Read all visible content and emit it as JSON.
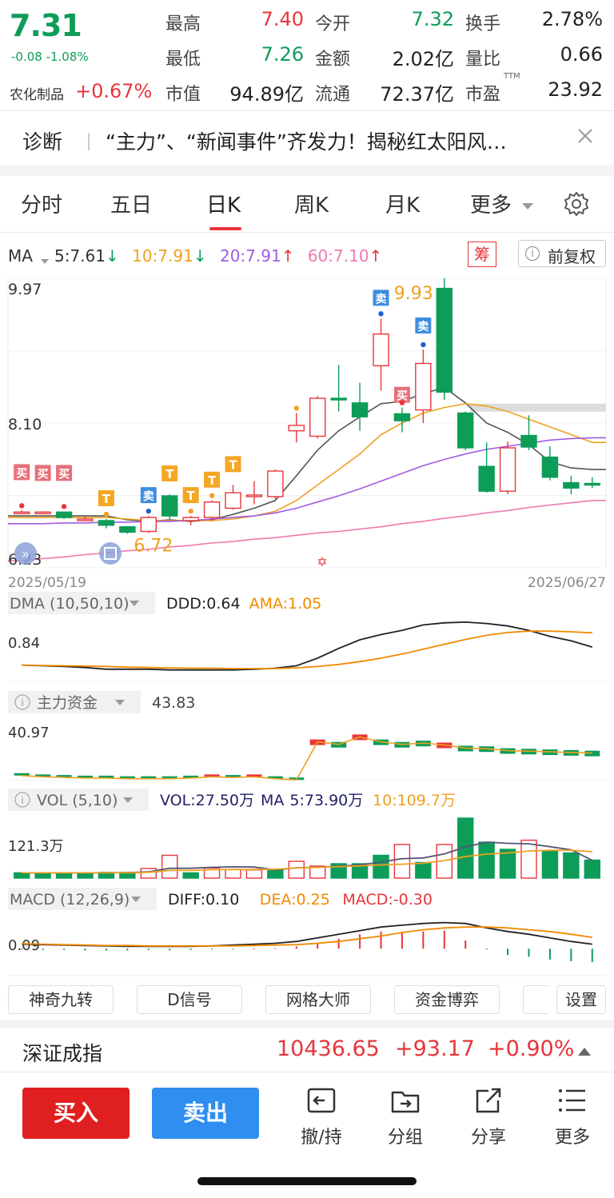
{
  "quote": {
    "price": "7.31",
    "change": "-0.08 -1.08%",
    "sector": "农化制品",
    "sector_change": "+0.67%",
    "fields": [
      {
        "label": "最高",
        "value": "7.40",
        "color": "#e8353b"
      },
      {
        "label": "今开",
        "value": "7.32",
        "color": "#0d9d58"
      },
      {
        "label": "换手",
        "value": "2.78%",
        "color": "#222222"
      },
      {
        "label": "最低",
        "value": "7.26",
        "color": "#0d9d58"
      },
      {
        "label": "金额",
        "value": "2.02亿",
        "color": "#222222"
      },
      {
        "label": "量比",
        "value": "0.66",
        "color": "#222222"
      },
      {
        "label": "市值",
        "value": "94.89亿",
        "color": "#222222"
      },
      {
        "label": "流通",
        "value": "72.37亿",
        "color": "#222222"
      },
      {
        "label": "市盈",
        "value": "23.92",
        "color": "#222222"
      }
    ],
    "pe_superscript": "TTM"
  },
  "news": {
    "label": "诊断",
    "headline": "“主力”、“新闻事件”齐发力！揭秘红太阳风…"
  },
  "tabs": [
    "分时",
    "五日",
    "日K",
    "周K",
    "月K",
    "更多"
  ],
  "active_tab": "日K",
  "ma_bar": {
    "label": "MA",
    "items": [
      {
        "text": "5:7.61",
        "arrow": "↓",
        "color": "#333333",
        "arrow_color": "#0d9d58"
      },
      {
        "text": "10:7.91",
        "arrow": "↓",
        "color": "#f0a020",
        "arrow_color": "#0d9d58"
      },
      {
        "text": "20:7.91",
        "arrow": "↑",
        "color": "#a05de0",
        "arrow_color": "#e8353b"
      },
      {
        "text": "60:7.10",
        "arrow": "↑",
        "color": "#f07ab0",
        "arrow_color": "#e8353b"
      }
    ],
    "chip_label": "筹",
    "adjust_label": "前复权"
  },
  "chart_data": [
    {
      "type": "candlestick",
      "title": "",
      "y_ticks": [
        "9.97",
        "8.10",
        "6.23"
      ],
      "ylim": [
        6.23,
        9.97
      ],
      "x_labels": [
        "2025/05/19",
        "2025/06/27"
      ],
      "annotations": [
        {
          "text": "9.93",
          "kind": "high"
        },
        {
          "text": "6.72",
          "kind": "low"
        }
      ],
      "signals": [
        "买",
        "买",
        "买",
        "T",
        "卖",
        "T",
        "T",
        "T",
        "T",
        "卖",
        "买",
        "卖"
      ],
      "candles": [
        {
          "o": 6.94,
          "c": 6.95,
          "h": 6.97,
          "l": 6.93
        },
        {
          "o": 6.94,
          "c": 6.95,
          "h": 6.96,
          "l": 6.92
        },
        {
          "o": 6.95,
          "c": 6.88,
          "h": 6.96,
          "l": 6.86
        },
        {
          "o": 6.86,
          "c": 6.86,
          "h": 6.89,
          "l": 6.84
        },
        {
          "o": 6.84,
          "c": 6.78,
          "h": 6.86,
          "l": 6.74
        },
        {
          "o": 6.76,
          "c": 6.69,
          "h": 6.77,
          "l": 6.67
        },
        {
          "o": 6.7,
          "c": 6.88,
          "h": 6.9,
          "l": 6.68
        },
        {
          "o": 7.16,
          "c": 6.9,
          "h": 7.18,
          "l": 6.86
        },
        {
          "o": 6.84,
          "c": 6.88,
          "h": 6.9,
          "l": 6.78
        },
        {
          "o": 6.88,
          "c": 7.08,
          "h": 7.1,
          "l": 6.84
        },
        {
          "o": 7.0,
          "c": 7.2,
          "h": 7.3,
          "l": 6.98
        },
        {
          "o": 7.15,
          "c": 7.17,
          "h": 7.35,
          "l": 7.05
        },
        {
          "o": 7.15,
          "c": 7.48,
          "h": 7.5,
          "l": 7.12
        },
        {
          "o": 8.0,
          "c": 8.07,
          "h": 8.23,
          "l": 7.85
        },
        {
          "o": 7.93,
          "c": 8.42,
          "h": 8.45,
          "l": 7.9
        },
        {
          "o": 8.42,
          "c": 8.4,
          "h": 8.85,
          "l": 8.25
        },
        {
          "o": 8.36,
          "c": 8.18,
          "h": 8.62,
          "l": 8.0
        },
        {
          "o": 8.84,
          "c": 9.25,
          "h": 9.45,
          "l": 8.52
        },
        {
          "o": 8.22,
          "c": 8.13,
          "h": 8.3,
          "l": 7.98
        },
        {
          "o": 8.27,
          "c": 8.87,
          "h": 9.05,
          "l": 8.1
        },
        {
          "o": 9.84,
          "c": 8.5,
          "h": 9.97,
          "l": 8.4
        },
        {
          "o": 8.23,
          "c": 7.78,
          "h": 8.25,
          "l": 7.75
        },
        {
          "o": 7.54,
          "c": 7.22,
          "h": 7.85,
          "l": 7.2
        },
        {
          "o": 7.22,
          "c": 7.78,
          "h": 7.86,
          "l": 7.18
        },
        {
          "o": 7.94,
          "c": 7.79,
          "h": 8.2,
          "l": 7.75
        },
        {
          "o": 7.66,
          "c": 7.4,
          "h": 7.8,
          "l": 7.36
        },
        {
          "o": 7.33,
          "c": 7.26,
          "h": 7.42,
          "l": 7.18
        },
        {
          "o": 7.32,
          "c": 7.31,
          "h": 7.4,
          "l": 7.26
        }
      ],
      "series": [
        {
          "name": "MA5",
          "color": "#555555",
          "values": [
            null,
            null,
            null,
            null,
            6.9,
            6.85,
            6.83,
            6.85,
            6.83,
            6.85,
            6.92,
            7.0,
            7.1,
            7.42,
            7.75,
            8.0,
            8.18,
            8.35,
            8.38,
            8.48,
            8.56,
            8.36,
            8.1,
            7.98,
            7.82,
            7.6,
            7.52,
            7.5
          ]
        },
        {
          "name": "MA10",
          "color": "#f0a020",
          "values": [
            null,
            null,
            null,
            null,
            6.88,
            6.86,
            6.84,
            6.84,
            6.84,
            6.84,
            6.86,
            6.9,
            6.96,
            7.1,
            7.3,
            7.5,
            7.7,
            7.95,
            8.1,
            8.23,
            8.3,
            8.35,
            8.32,
            8.25,
            8.15,
            8.05,
            7.95,
            7.85
          ]
        },
        {
          "name": "MA20",
          "color": "#a05de0",
          "values": [
            6.8,
            6.8,
            6.81,
            6.81,
            6.82,
            6.82,
            6.83,
            6.83,
            6.84,
            6.86,
            6.88,
            6.9,
            6.94,
            7.0,
            7.08,
            7.16,
            7.25,
            7.35,
            7.45,
            7.55,
            7.63,
            7.7,
            7.76,
            7.8,
            7.84,
            7.88,
            7.9,
            7.91
          ]
        },
        {
          "name": "MA60",
          "color": "#f07ab0",
          "values": [
            6.32,
            6.35,
            6.37,
            6.4,
            6.42,
            6.45,
            6.47,
            6.5,
            6.52,
            6.55,
            6.57,
            6.6,
            6.62,
            6.65,
            6.68,
            6.7,
            6.73,
            6.76,
            6.8,
            6.83,
            6.87,
            6.9,
            6.94,
            6.97,
            7.01,
            7.04,
            7.07,
            7.1
          ]
        }
      ]
    },
    {
      "type": "line",
      "title": "DMA (10,50,10)",
      "legend": [
        {
          "text": "DDD:0.64",
          "color": "#222222"
        },
        {
          "text": "AMA:1.05",
          "color": "#f08a00"
        }
      ],
      "y_ticks": [
        "0.84"
      ],
      "ylim": [
        -0.35,
        1.45
      ],
      "series": [
        {
          "name": "DDD",
          "color": "#222222",
          "values": [
            0.12,
            0.1,
            0.08,
            0.05,
            0.0,
            0.0,
            0.0,
            -0.02,
            -0.02,
            -0.02,
            -0.02,
            0.0,
            0.03,
            0.1,
            0.32,
            0.6,
            0.85,
            1.0,
            1.12,
            1.28,
            1.34,
            1.36,
            1.32,
            1.25,
            1.12,
            0.95,
            0.82,
            0.64
          ]
        },
        {
          "name": "AMA",
          "color": "#f08a00",
          "values": [
            0.12,
            0.11,
            0.1,
            0.09,
            0.08,
            0.06,
            0.05,
            0.04,
            0.03,
            0.03,
            0.02,
            0.02,
            0.02,
            0.04,
            0.08,
            0.14,
            0.22,
            0.32,
            0.44,
            0.58,
            0.72,
            0.86,
            0.98,
            1.06,
            1.1,
            1.1,
            1.08,
            1.05
          ]
        }
      ]
    },
    {
      "type": "bar",
      "title": "主力资金",
      "legend": [
        {
          "text": "43.83",
          "color": "#444444"
        }
      ],
      "y_ticks": [
        "40.97"
      ],
      "ylim": [
        0,
        100
      ],
      "values": [
        8,
        6,
        5,
        4,
        4,
        3,
        3,
        3,
        4,
        6,
        5,
        6,
        3,
        1,
        62,
        58,
        70,
        62,
        58,
        60,
        57,
        52,
        51,
        48,
        47,
        46,
        45,
        44
      ],
      "bar_colors": [
        "#0d9d58",
        "#0d9d58",
        "#0d9d58",
        "#0d9d58",
        "#0d9d58",
        "#0d9d58",
        "#0d9d58",
        "#0d9d58",
        "#0d9d58",
        "#e8353b",
        "#0d9d58",
        "#e8353b",
        "#0d9d58",
        "#0d9d58",
        "#e8353b",
        "#0d9d58",
        "#e8353b",
        "#0d9d58",
        "#0d9d58",
        "#0d9d58",
        "#e8353b",
        "#0d9d58",
        "#0d9d58",
        "#0d9d58",
        "#0d9d58",
        "#0d9d58",
        "#0d9d58",
        "#0d9d58"
      ]
    },
    {
      "type": "bar",
      "title": "VOL (5,10)",
      "legend": [
        {
          "text": "VOL:27.50万",
          "color": "#222266"
        },
        {
          "text": "MA",
          "color": "#222266"
        },
        {
          "text": "5:73.90万",
          "color": "#222266"
        },
        {
          "text": "10:109.7万",
          "color": "#f0a020"
        }
      ],
      "y_ticks": [
        "121.3万"
      ],
      "ylim": [
        0,
        260
      ],
      "values": [
        22,
        22,
        22,
        22,
        24,
        24,
        40,
        95,
        22,
        42,
        36,
        34,
        34,
        70,
        50,
        60,
        60,
        95,
        140,
        65,
        140,
        250,
        150,
        120,
        158,
        112,
        105,
        75
      ],
      "bar_colors": [
        "#0d9d58",
        "#0d9d58",
        "#0d9d58",
        "#0d9d58",
        "#0d9d58",
        "#0d9d58",
        "#e8353b",
        "#e8353b",
        "#0d9d58",
        "#e8353b",
        "#e8353b",
        "#e8353b",
        "#0d9d58",
        "#e8353b",
        "#e8353b",
        "#0d9d58",
        "#0d9d58",
        "#0d9d58",
        "#e8353b",
        "#0d9d58",
        "#e8353b",
        "#0d9d58",
        "#0d9d58",
        "#0d9d58",
        "#e8353b",
        "#0d9d58",
        "#0d9d58",
        "#0d9d58"
      ],
      "series": [
        {
          "name": "MA5",
          "color": "#555577",
          "values": [
            22,
            22,
            22,
            22,
            22,
            23,
            26,
            41,
            41,
            45,
            47,
            46,
            34,
            43,
            45,
            50,
            55,
            67,
            81,
            84,
            101,
            130,
            150,
            145,
            143,
            131,
            118,
            74
          ]
        },
        {
          "name": "MA10",
          "color": "#f0a020",
          "values": [
            22,
            22,
            22,
            22,
            22,
            22,
            24,
            32,
            32,
            35,
            36,
            36,
            37,
            42,
            45,
            48,
            51,
            55,
            58,
            62,
            73,
            90,
            100,
            105,
            113,
            116,
            116,
            110
          ]
        }
      ]
    },
    {
      "type": "bar",
      "title": "MACD (12,26,9)",
      "legend": [
        {
          "text": "DIFF:0.10",
          "color": "#222222"
        },
        {
          "text": "DEA:0.25",
          "color": "#f08a00"
        },
        {
          "text": "MACD:-0.30",
          "color": "#e8353b"
        }
      ],
      "y_ticks": [
        "0.09"
      ],
      "ylim": [
        -0.6,
        0.75
      ],
      "values": [
        -0.02,
        -0.03,
        -0.03,
        -0.04,
        -0.04,
        -0.04,
        -0.03,
        -0.04,
        -0.03,
        -0.02,
        -0.01,
        0.0,
        0.01,
        0.05,
        0.12,
        0.22,
        0.32,
        0.38,
        0.35,
        0.38,
        0.4,
        0.18,
        -0.02,
        -0.14,
        -0.18,
        -0.24,
        -0.28,
        -0.3
      ],
      "bar_colors": [
        "#0d9d58",
        "#0d9d58",
        "#0d9d58",
        "#0d9d58",
        "#0d9d58",
        "#0d9d58",
        "#0d9d58",
        "#0d9d58",
        "#0d9d58",
        "#0d9d58",
        "#0d9d58",
        "#e8353b",
        "#e8353b",
        "#e8353b",
        "#e8353b",
        "#e8353b",
        "#e8353b",
        "#e8353b",
        "#e8353b",
        "#e8353b",
        "#e8353b",
        "#e8353b",
        "#0d9d58",
        "#0d9d58",
        "#0d9d58",
        "#0d9d58",
        "#0d9d58",
        "#0d9d58"
      ],
      "series": [
        {
          "name": "DIFF",
          "color": "#222222",
          "values": [
            0.1,
            0.09,
            0.08,
            0.07,
            0.06,
            0.05,
            0.05,
            0.05,
            0.05,
            0.06,
            0.08,
            0.1,
            0.12,
            0.16,
            0.24,
            0.32,
            0.4,
            0.48,
            0.52,
            0.56,
            0.58,
            0.56,
            0.46,
            0.38,
            0.32,
            0.24,
            0.16,
            0.1
          ]
        },
        {
          "name": "DEA",
          "color": "#f08a00",
          "values": [
            0.11,
            0.1,
            0.09,
            0.08,
            0.07,
            0.07,
            0.06,
            0.06,
            0.06,
            0.06,
            0.06,
            0.07,
            0.08,
            0.09,
            0.12,
            0.16,
            0.22,
            0.28,
            0.36,
            0.42,
            0.46,
            0.48,
            0.48,
            0.46,
            0.42,
            0.38,
            0.32,
            0.25
          ]
        }
      ]
    }
  ],
  "tools": [
    "神奇九转",
    "D信号",
    "网格大师",
    "资金博弈",
    "设置"
  ],
  "index_bar": {
    "name": "深证成指",
    "value": "10436.65",
    "change": "+93.17",
    "pct": "+0.90%"
  },
  "actions": {
    "buy": "买入",
    "sell": "卖出"
  },
  "nav": [
    "撤/持",
    "分组",
    "分享",
    "更多"
  ]
}
